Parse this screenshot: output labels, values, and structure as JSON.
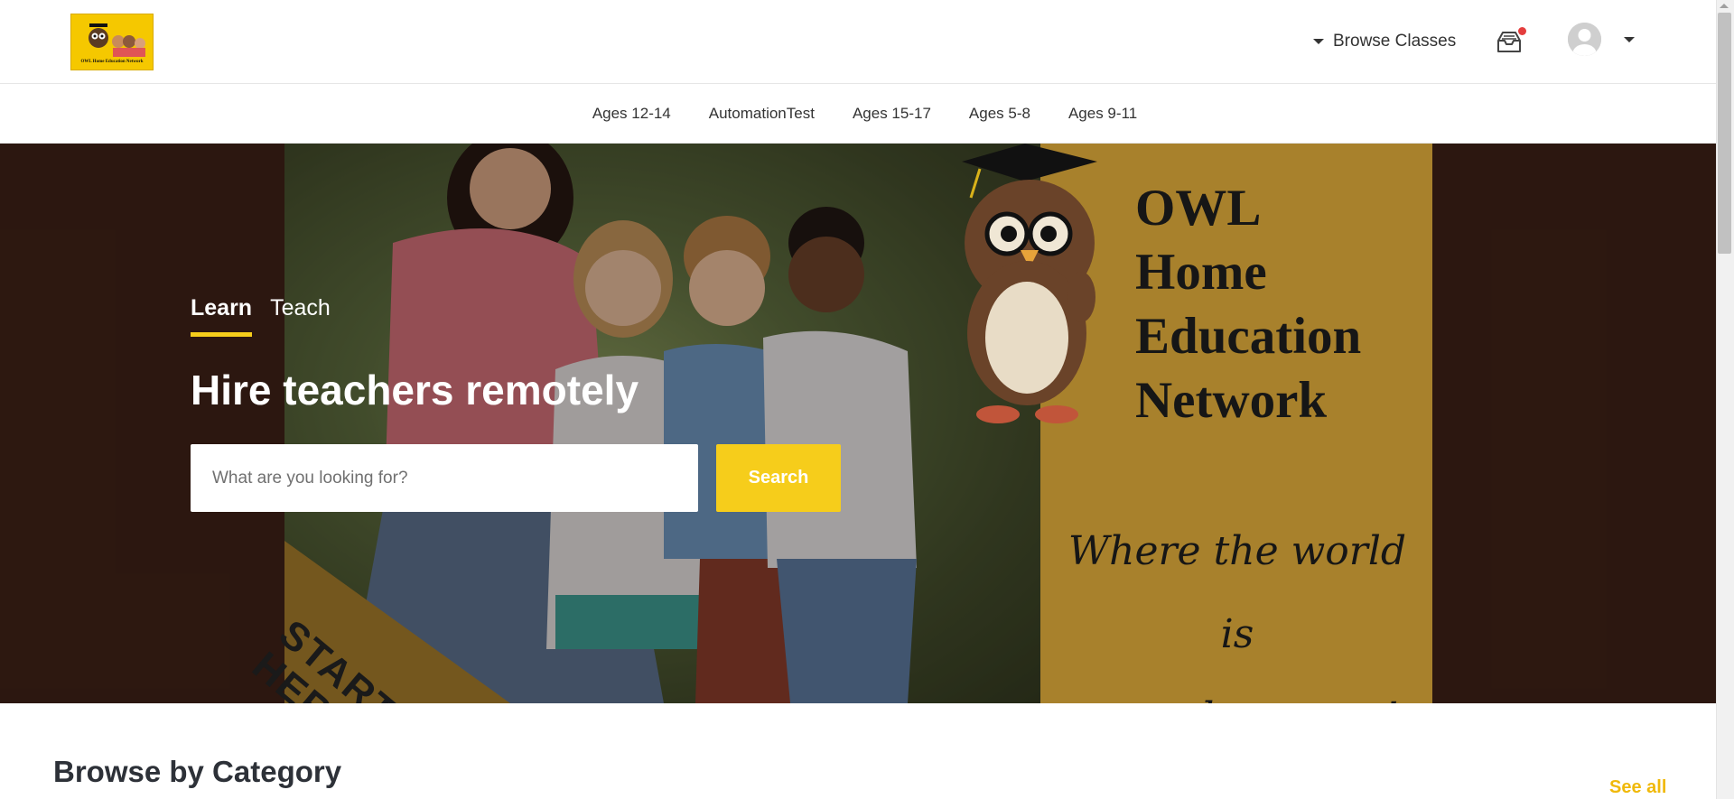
{
  "header": {
    "logo_caption": "OWL Home Education Network",
    "browse_label": "Browse Classes",
    "icons": {
      "browse_caret": "caret-down-icon",
      "inbox": "inbox-icon",
      "avatar": "user-avatar-icon",
      "avatar_caret": "caret-down-icon"
    },
    "notification_color": "#e43d3d"
  },
  "category_nav": {
    "items": [
      "Ages 12-14",
      "AutomationTest",
      "Ages 15-17",
      "Ages 5-8",
      "Ages 9-11"
    ]
  },
  "hero": {
    "tabs": [
      {
        "label": "Learn",
        "active": true
      },
      {
        "label": "Teach",
        "active": false
      }
    ],
    "title": "Hire teachers remotely",
    "search": {
      "placeholder": "What are you looking for?",
      "value": "",
      "button_label": "Search"
    },
    "poster": {
      "title_lines": [
        "OWL",
        "Home",
        "Education",
        "Network"
      ],
      "tagline_lines": [
        "Where the world is",
        "your classroom!"
      ],
      "corner_lines": [
        "START",
        "HERE"
      ]
    },
    "accent_color": "#f6cd1b"
  },
  "browse_section": {
    "title": "Browse by Category",
    "see_all_label": "See all",
    "link_color": "#f0b90b"
  }
}
